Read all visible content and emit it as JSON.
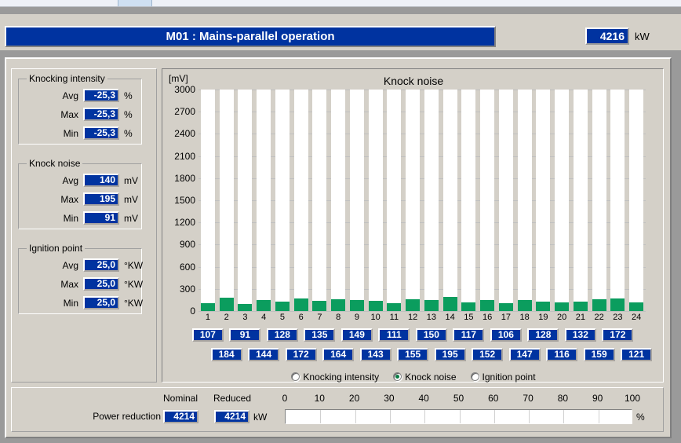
{
  "header": {
    "title": "M01 : Mains-parallel operation",
    "power_value": "4216",
    "power_unit": "kW"
  },
  "groups": [
    {
      "legend": "Knocking intensity",
      "rows": [
        {
          "label": "Avg",
          "value": "-25,3",
          "unit": "%"
        },
        {
          "label": "Max",
          "value": "-25,3",
          "unit": "%"
        },
        {
          "label": "Min",
          "value": "-25,3",
          "unit": "%"
        }
      ]
    },
    {
      "legend": "Knock noise",
      "rows": [
        {
          "label": "Avg",
          "value": "140",
          "unit": "mV"
        },
        {
          "label": "Max",
          "value": "195",
          "unit": "mV"
        },
        {
          "label": "Min",
          "value": "91",
          "unit": "mV"
        }
      ]
    },
    {
      "legend": "Ignition point",
      "rows": [
        {
          "label": "Avg",
          "value": "25,0",
          "unit": "°KW"
        },
        {
          "label": "Max",
          "value": "25,0",
          "unit": "°KW"
        },
        {
          "label": "Min",
          "value": "25,0",
          "unit": "°KW"
        }
      ]
    }
  ],
  "chart_data": {
    "type": "bar",
    "title": "Knock noise",
    "xlabel": "",
    "ylabel": "[mV]",
    "unit_label": "[mV]",
    "ylim": [
      0,
      3000
    ],
    "grid": true,
    "yticks": [
      3000,
      2700,
      2400,
      2100,
      1800,
      1500,
      1200,
      900,
      600,
      300,
      0
    ],
    "categories": [
      "1",
      "2",
      "3",
      "4",
      "5",
      "6",
      "7",
      "8",
      "9",
      "10",
      "11",
      "12",
      "13",
      "14",
      "15",
      "16",
      "17",
      "18",
      "19",
      "20",
      "21",
      "22",
      "23",
      "24"
    ],
    "values": [
      107,
      184,
      91,
      144,
      128,
      172,
      135,
      164,
      149,
      143,
      111,
      155,
      150,
      195,
      117,
      152,
      106,
      147,
      128,
      116,
      132,
      159,
      172,
      121
    ],
    "bar_color": "#0b9d5e"
  },
  "cylinder_boxes": {
    "odd": [
      "107",
      "128",
      "149",
      "111",
      "150",
      "117",
      "106",
      "128",
      "132",
      "172"
    ],
    "even": [
      "184",
      "144",
      "172",
      "164",
      "143",
      "155",
      "195",
      "152",
      "147",
      "116",
      "159",
      "121"
    ],
    "odd_full": [
      "107",
      "91",
      "128",
      "135",
      "149",
      "111",
      "150",
      "117",
      "106",
      "128",
      "132",
      "172"
    ],
    "row1": [
      "107",
      "91",
      "128",
      "135",
      "149",
      "111",
      "150",
      "117",
      "106",
      "128",
      "132",
      "172"
    ],
    "row2": [
      "184",
      "144",
      "172",
      "164",
      "143",
      "155",
      "195",
      "152",
      "147",
      "116",
      "159",
      "121"
    ]
  },
  "radios": [
    {
      "label": "Knocking intensity",
      "selected": false
    },
    {
      "label": "Knock noise",
      "selected": true
    },
    {
      "label": "Ignition point",
      "selected": false
    }
  ],
  "power_reduction": {
    "nominal_label": "Nominal",
    "reduced_label": "Reduced",
    "row_label": "Power reduction",
    "nominal_value": "4214",
    "reduced_value": "4214",
    "unit": "kW",
    "percent_unit": "%",
    "percent_value": 0,
    "scale_ticks": [
      "0",
      "10",
      "20",
      "30",
      "40",
      "50",
      "60",
      "70",
      "80",
      "90",
      "100"
    ]
  },
  "colors": {
    "accent_blue": "#0033a0",
    "bar_green": "#0b9d5e",
    "face": "#d4d0c8"
  }
}
